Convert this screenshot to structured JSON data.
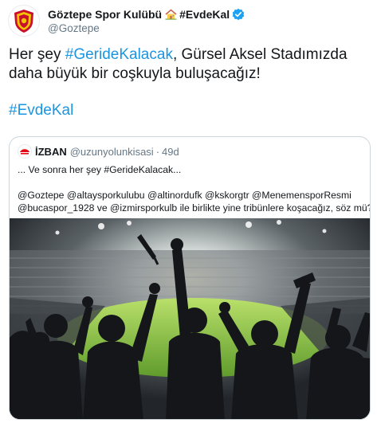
{
  "account": {
    "display_name": "Göztepe Spor Kulübü",
    "name_suffix": "#EvdeKal",
    "handle": "@Goztepe",
    "avatar_icon": "goztepe-crest-icon",
    "house_icon": "house-emoji-icon",
    "verified_icon": "verified-badge-icon"
  },
  "tweet": {
    "text_before": "Her şey ",
    "hashtag_1": "#GerideKalacak",
    "text_after": ", Gürsel Aksel Stadımızda daha büyük bir coşkuyla buluşacağız!",
    "hashtag_2": "#EvdeKal"
  },
  "quoted_tweet": {
    "logo_icon": "izban-logo-icon",
    "name": "İZBAN",
    "handle": "@uzunyolunkisasi",
    "separator": "·",
    "time": "49d",
    "line_1": "... Ve sonra her şey #GerideKalacak...",
    "line_2": "@Goztepe @altaysporkulubu @altinordufk @kskorgtr @MenemensporResmi",
    "line_3": "@bucaspor_1928 ve @izmirsporkulb ile birlikte yine tribünlere koşacağız, söz mü?",
    "image_description_icon": "stadium-fans-photo"
  },
  "colors": {
    "link": "#1b95e0",
    "text": "#14171a",
    "muted": "#657786",
    "border": "#ccd6dd",
    "verified": "#1da1f2",
    "brand_red": "#c8102e",
    "brand_yellow": "#f5c400"
  }
}
